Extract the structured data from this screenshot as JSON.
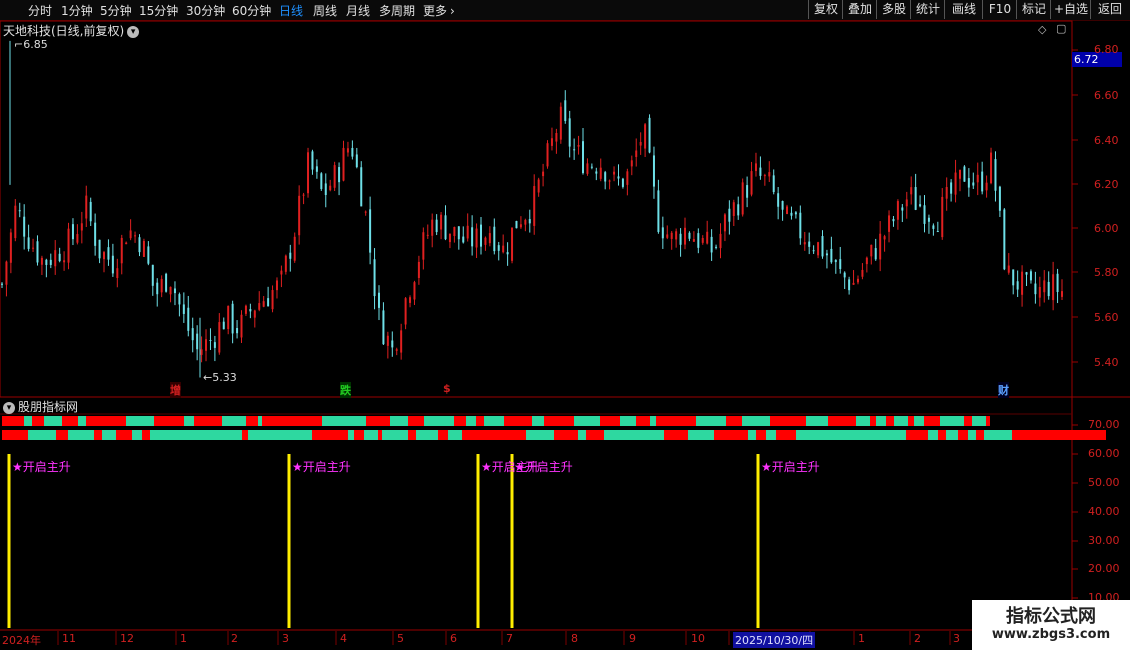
{
  "toolbar": {
    "timeframes": [
      "分时",
      "1分钟",
      "5分钟",
      "15分钟",
      "30分钟",
      "60分钟",
      "日线",
      "周线",
      "月线",
      "多周期",
      "更多"
    ],
    "active_timeframe": "日线",
    "more_chevron": "›",
    "right_buttons": [
      "复权",
      "叠加",
      "多股",
      "统计",
      "画线",
      "F10",
      "标记",
      "+自选",
      "返回"
    ]
  },
  "main_chart": {
    "title": "天地科技(日线,前复权)",
    "high_label": "6.85",
    "low_label": "5.33",
    "current_price": "6.72",
    "y_ticks": [
      "6.80",
      "6.60",
      "6.40",
      "6.20",
      "6.00",
      "5.80",
      "5.60",
      "5.40"
    ],
    "markers": [
      {
        "text": "增",
        "color": "#d02020"
      },
      {
        "text": "跌",
        "color": "#22cc22"
      },
      {
        "text": "$",
        "color": "#d02020"
      },
      {
        "text": "财",
        "color": "#5aa0ff"
      }
    ]
  },
  "indicator": {
    "title": "股朋指标网",
    "y_ticks": [
      "70.00",
      "60.00",
      "50.00",
      "40.00",
      "30.00",
      "20.00",
      "10.00"
    ],
    "signal_label": "★开启主升",
    "signals": [
      "★开启主升",
      "★开启主升",
      "★开启主升",
      "★开启主升",
      "★开启主升"
    ]
  },
  "x_axis": {
    "labels": [
      "2024年",
      "11",
      "12",
      "1",
      "2",
      "3",
      "4",
      "5",
      "6",
      "7",
      "8",
      "9",
      "10",
      "1",
      "2",
      "3"
    ],
    "highlight_date": "2025/10/30/四"
  },
  "watermark": {
    "line1": "指标公式网",
    "line2": "www.zbgs3.com"
  },
  "colors": {
    "up": "#e02020",
    "down": "#6ee0e8",
    "bar_red": "#ff0000",
    "bar_green": "#2ed8a0",
    "signal_line": "#ffee00",
    "accent": "#1e90ff"
  },
  "chart_data": {
    "type": "candlestick",
    "title": "天地科技(日线,前复权)",
    "y_range": [
      5.3,
      6.85
    ],
    "high": 6.85,
    "low": 5.33,
    "last": 6.72,
    "close_series": [
      5.75,
      6.1,
      5.95,
      5.85,
      5.9,
      5.95,
      6.1,
      5.9,
      5.85,
      6.0,
      5.95,
      5.7,
      5.8,
      5.6,
      5.45,
      5.5,
      5.6,
      5.55,
      5.65,
      5.7,
      5.75,
      6.0,
      6.3,
      6.15,
      6.25,
      6.4,
      6.1,
      5.6,
      5.45,
      5.7,
      5.9,
      6.05,
      6.0,
      5.95,
      5.95,
      6.0,
      5.9,
      6.05,
      6.1,
      6.3,
      6.5,
      6.35,
      6.3,
      6.3,
      6.2,
      6.25,
      6.45,
      6.05,
      5.95,
      6.0,
      5.95,
      5.9,
      6.05,
      6.15,
      6.25,
      6.2,
      6.05,
      6.0,
      5.95,
      5.9,
      5.8,
      5.75,
      5.85,
      5.95,
      6.05,
      6.15,
      6.1,
      6.05,
      6.15,
      6.25,
      6.2,
      6.3,
      5.8,
      5.75,
      5.7,
      5.75,
      5.72
    ]
  }
}
